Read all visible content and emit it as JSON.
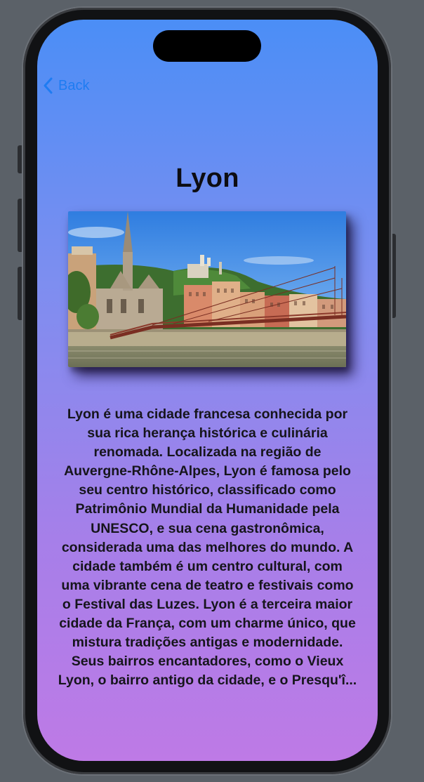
{
  "nav": {
    "back_label": "Back"
  },
  "city": {
    "title": "Lyon",
    "description": "Lyon é uma cidade francesa conhecida por sua rica herança histórica e culinária renomada. Localizada na região de Auvergne-Rhône-Alpes, Lyon é famosa pelo seu centro histórico, classificado como Patrimônio Mundial da Humanidade pela UNESCO, e sua cena gastronômica, considerada uma das melhores do mundo. A cidade também é um centro cultural, com uma vibrante cena de teatro e festivais como o Festival das Luzes. Lyon é a terceira maior cidade da França, com um charme único, que mistura tradições antigas e modernidade. Seus bairros encantadores, como o Vieux Lyon, o bairro antigo da cidade, e o Presqu'î...",
    "description_lines": [
      "Lyon é uma cidade francesa conhecida por",
      "sua rica herança histórica e culinária",
      "renomada. Localizada na região de",
      "Auvergne-Rhône-Alpes, Lyon é famosa pelo",
      "seu centro histórico, classificado como",
      "Patrimônio Mundial da Humanidade pela",
      "UNESCO, e sua cena gastronômica,",
      "considerada uma das melhores do mundo. A",
      "cidade também é um centro cultural, com",
      "uma vibrante cena de teatro e festivais como",
      "o Festival das Luzes. Lyon é a terceira maior",
      "cidade da França, com um charme único, que",
      "mistura tradições antigas e modernidade.",
      "Seus bairros encantadores, como o Vieux",
      "Lyon, o bairro antigo da cidade, e o Presqu'î..."
    ]
  },
  "icons": {
    "back": "chevron-left-icon"
  },
  "colors": {
    "accent": "#1e7cf2",
    "gradient_top": "#4b8ef6",
    "gradient_bottom": "#be7ae6",
    "text": "#16151c"
  }
}
